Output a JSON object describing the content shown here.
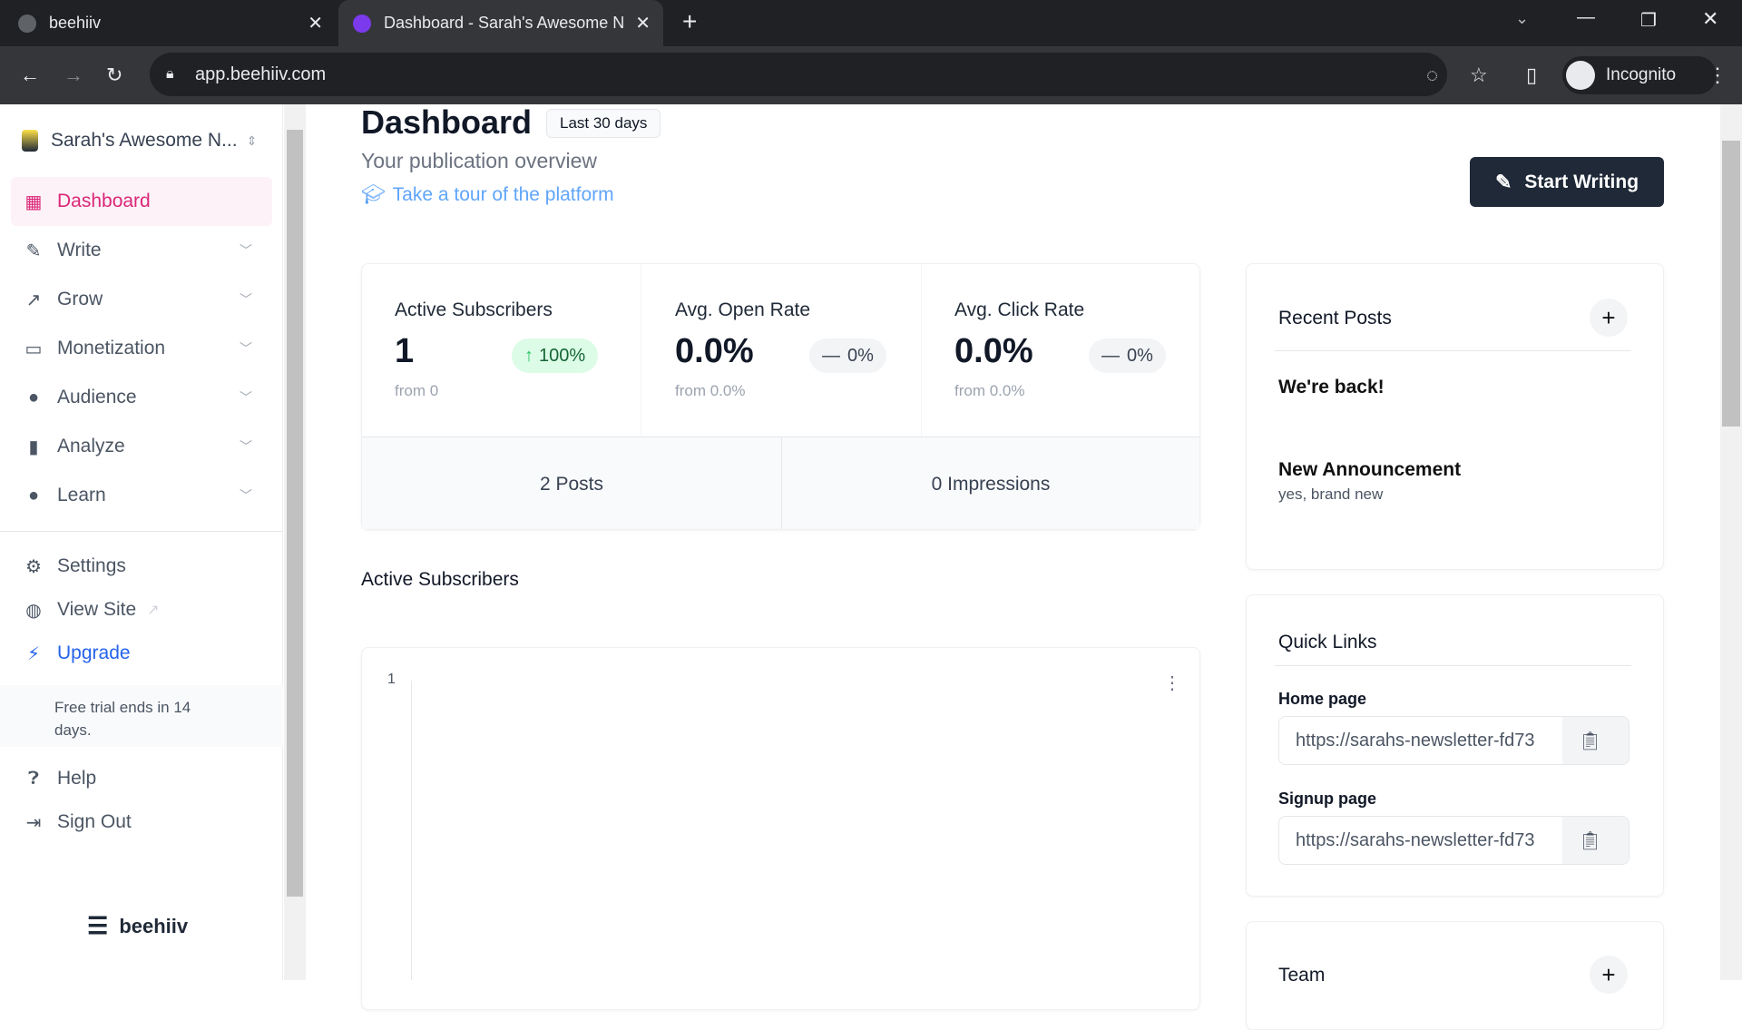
{
  "browser": {
    "tabs": [
      {
        "title": "beehiiv"
      },
      {
        "title": "Dashboard - Sarah's Awesome N"
      }
    ],
    "url": "app.beehiiv.com",
    "profile": "Incognito"
  },
  "sidebar": {
    "publication": "Sarah's Awesome N...",
    "items": [
      {
        "label": "Dashboard",
        "icon": "grid-icon"
      },
      {
        "label": "Write",
        "icon": "pencil-icon"
      },
      {
        "label": "Grow",
        "icon": "trend-icon"
      },
      {
        "label": "Monetization",
        "icon": "cash-icon"
      },
      {
        "label": "Audience",
        "icon": "users-icon"
      },
      {
        "label": "Analyze",
        "icon": "bar-chart-icon"
      },
      {
        "label": "Learn",
        "icon": "lightbulb-icon"
      }
    ],
    "settings": "Settings",
    "view_site": "View Site",
    "upgrade": "Upgrade",
    "trial": "Free trial ends in 14 days.",
    "help": "Help",
    "sign_out": "Sign Out",
    "logo": "beehiiv"
  },
  "header": {
    "title": "Dashboard",
    "range": "Last 30 days",
    "subtitle": "Your publication overview",
    "tour": "Take a tour of the platform",
    "start_writing": "Start Writing"
  },
  "stats": [
    {
      "label": "Active Subscribers",
      "value": "1",
      "change": "100%",
      "from": "from 0",
      "trend": "up"
    },
    {
      "label": "Avg. Open Rate",
      "value": "0.0%",
      "change": "0%",
      "from": "from 0.0%",
      "trend": "flat"
    },
    {
      "label": "Avg. Click Rate",
      "value": "0.0%",
      "change": "0%",
      "from": "from 0.0%",
      "trend": "flat"
    }
  ],
  "totals": {
    "posts": "2 Posts",
    "impressions": "0 Impressions"
  },
  "subscribers_chart": {
    "title": "Active Subscribers",
    "y_tick": "1"
  },
  "recent_posts": {
    "title": "Recent Posts",
    "posts": [
      {
        "title": "We're back!",
        "subtitle": ""
      },
      {
        "title": "New Announcement",
        "subtitle": "yes, brand new"
      }
    ]
  },
  "quick_links": {
    "title": "Quick Links",
    "home_label": "Home page",
    "home_url": "https://sarahs-newsletter-fd73",
    "signup_label": "Signup page",
    "signup_url": "https://sarahs-newsletter-fd73"
  },
  "team": {
    "title": "Team"
  },
  "colors": {
    "accent": "#db2777",
    "upgrade": "#2563eb",
    "dark_button": "#1f2937",
    "positive": "#22c55e"
  }
}
